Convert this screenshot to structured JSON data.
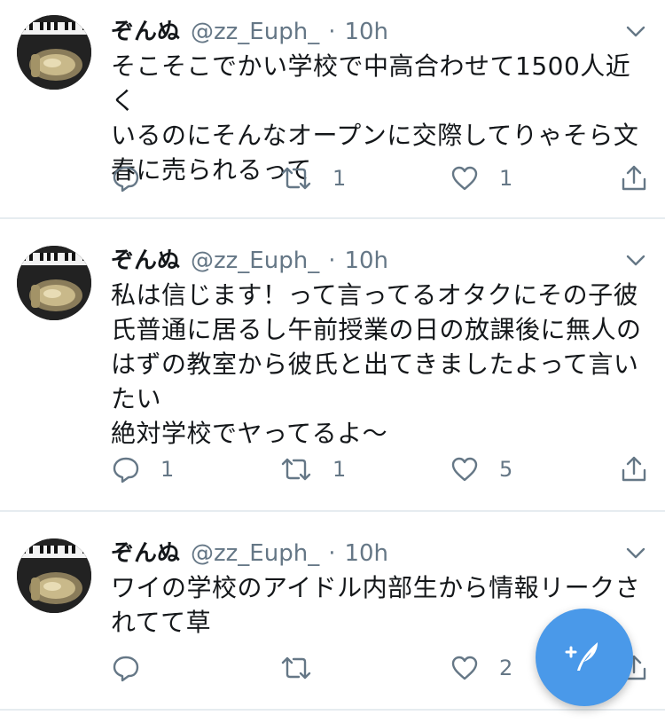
{
  "tweets": [
    {
      "name": "ぞんぬ",
      "handle": "@zz_Euph_",
      "sep": "·",
      "time": "10h",
      "text": "そこそこでかい学校で中高合わせて1500人近く\nいるのにそんなオープンに交際してりゃそら文\n春に売られるって",
      "replies": "",
      "retweets": "1",
      "likes": "1"
    },
    {
      "name": "ぞんぬ",
      "handle": "@zz_Euph_",
      "sep": "·",
      "time": "10h",
      "text": "私は信じます！って言ってるオタクにその子彼\n氏普通に居るし午前授業の日の放課後に無人の\nはずの教室から彼氏と出てきましたよって言い\nたい\n絶対学校でヤってるよ〜",
      "replies": "1",
      "retweets": "1",
      "likes": "5"
    },
    {
      "name": "ぞんぬ",
      "handle": "@zz_Euph_",
      "sep": "·",
      "time": "10h",
      "text": "ワイの学校のアイドル内部生から情報リークさ\nれてて草",
      "replies": "",
      "retweets": "",
      "likes": "2"
    }
  ],
  "icons": {
    "reply": "reply-icon",
    "retweet": "retweet-icon",
    "like": "heart-icon",
    "share": "share-icon",
    "more": "chevron-down-icon",
    "compose": "compose-tweet-icon"
  },
  "colors": {
    "accent": "#4a99e9",
    "secondary_text": "#657786",
    "divider": "#e6ecf0"
  }
}
